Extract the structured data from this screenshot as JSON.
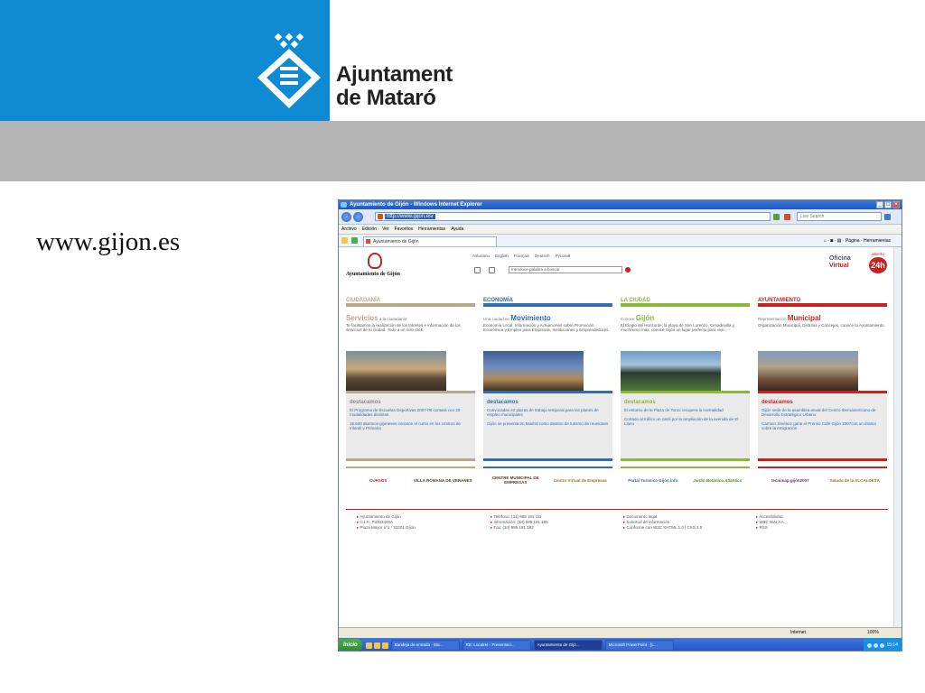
{
  "header": {
    "logo_line1": "Ajuntament",
    "logo_line2": "de Mataró"
  },
  "caption": "www.gijon.es",
  "browser": {
    "window_title": "Ayuntamiento de Gijón - Windows Internet Explorer",
    "url": "http://www.gijon.es/",
    "search_placeholder": "Live Search",
    "menu": [
      "Archivo",
      "Edición",
      "Ver",
      "Favoritos",
      "Herramientas",
      "Ayuda"
    ],
    "tab_label": "Ayuntamiento de Gijón",
    "cmd_page": "Página",
    "cmd_tools": "Herramientas",
    "status_zone": "Internet",
    "zoom": "100%"
  },
  "site": {
    "logo_name": "Ayuntamiento de Gijón",
    "languages": [
      "Asturianu",
      "English",
      "Français",
      "Deutsch",
      "Русский"
    ],
    "search_placeholder": "Introduce palabra a buscar",
    "oficina": "Oficina",
    "virtual": "Virtual",
    "abierto": "abierto",
    "hours": "24h",
    "columns": [
      {
        "head": "CIUDADANÍA",
        "title_big": "Servicios",
        "title_small": "a la ciudadanía",
        "desc": "Te facilitamos la realización de los trámites e información de los servicios de tu ciudad. Todo a un solo click.",
        "dest_title": "destacamos",
        "items": [
          "El Programa de Escuelas Deportivas 2007-08 contará con 20 modalidades distintas",
          "16.600 alumnos gijoneses iniciaron el curso en los centros de Infantil y Primaria"
        ],
        "banners": [
          "CURSOS",
          "VILLA ROMANA DE VERANES"
        ]
      },
      {
        "head": "ECONOMÍA",
        "title_small": "Una ciudad en",
        "title_big": "Movimiento",
        "desc": "Economía Local: Información y Actuaciones sobre Promoción Económica y Empleo para Empresas, Instituciones y Emprendedores.",
        "dest_title": "destacamos",
        "items": [
          "Convocadas 42 plazas de trabajo temporal para los planes de empleo municipales",
          "Gijón se presenta en Madrid como destino de turismo de reuniones"
        ],
        "banners": [
          "CENTRE MUNICIPAL DE EMPRESAS",
          "Centro Virtual de Empresas"
        ]
      },
      {
        "head": "LA CIUDAD",
        "title_small": "Conoce",
        "title_big": "Gijón",
        "desc": "El Elogio del Horizonte, la playa de San Lorenzo, Cimadevilla y muchísimo más, conoce Gijón un lugar perfecto para vivir.",
        "dest_title": "destacamos",
        "items": [
          "El entorno de la Plaza de Toros recupera la normalidad",
          "Cortado al tráfico un carril por la ampliación de la avenida de El Llano"
        ],
        "banners": [
          "Portal Turístico Gijón info",
          "Jardín Botánico Atlántico"
        ]
      },
      {
        "head": "AYUNTAMIENTO",
        "title_small": "Representación",
        "title_big": "Municipal",
        "desc": "Organización Municipal, Distritos y Concejos, conoce tu Ayuntamiento.",
        "dest_title": "destacamos",
        "items": [
          "Gijón sede de la asamblea anual del Centro Iberoamericano de Desarrollo Estratégico Urbano",
          "Carmen Jiménez gana el Premio Café Gijón 2007con un drama sobre la emigración"
        ],
        "banners": [
          "tecnimap gijón2007",
          "Saludo de la ALCALDESA"
        ]
      }
    ],
    "footer": [
      [
        "Ayuntamiento de Gijón",
        "C.I.F.: P3302400A",
        "Plaza Mayor nº1 - 33201 Gijón"
      ],
      [
        "Teléfono: (34) 985 181 111",
        "Información: (34) 985 181 105",
        "Fax: (34) 985 181 182"
      ],
      [
        "Documento legal",
        "Solicitud de información",
        "Conforme con W3C XHTML 1.0 | CSS 2.0"
      ],
      [
        "Accesibilidad",
        "W3C WAI-AA",
        "RSS"
      ]
    ]
  },
  "taskbar": {
    "start": "Inicio",
    "tasks": [
      "Bandeja de entrada - Mic...",
      "RE: Localret - Presentaci...",
      "Ayuntamiento de Gijó...",
      "Microsoft PowerPoint - [L..."
    ],
    "clock": "15:14"
  },
  "colors": {
    "header_blue": "#0f8bd4",
    "ciudadania": "#b6a98a",
    "economia": "#2f6cb0",
    "ciudad": "#8ab93a",
    "ayuntamiento": "#c8211f"
  }
}
